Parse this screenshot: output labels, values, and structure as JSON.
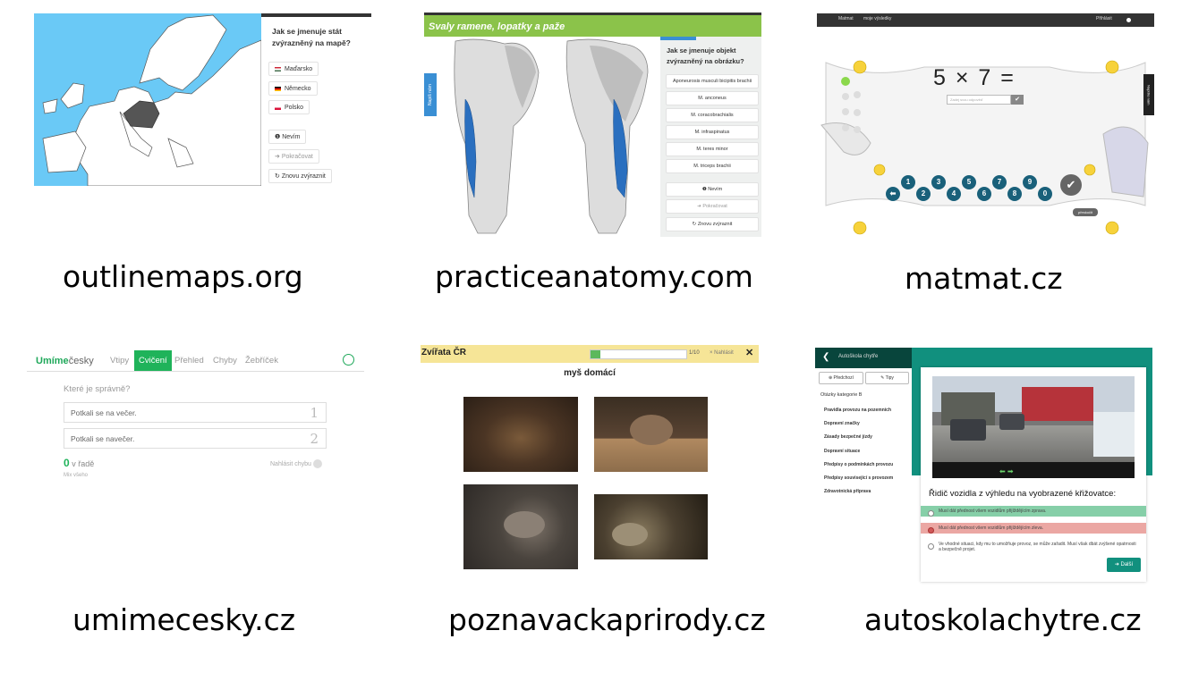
{
  "colors": {
    "map_sea": "#6ac9f6",
    "anatomy_green": "#8bc34a",
    "umime_green": "#1fb35a",
    "poznavacka_yellow": "#f6e597",
    "autoskola_teal": "#11907e"
  },
  "captions": {
    "outlinemaps": "outlinemaps.org",
    "practiceanatomy": "practiceanatomy.com",
    "matmat": "matmat.cz",
    "umimecesky": "umimecesky.cz",
    "poznavackaprirody": "poznavackaprirody.cz",
    "autoskolachytre": "autoskolachytre.cz"
  },
  "outlinemaps": {
    "question": "Jak se jmenuje stát zvýrazněný na mapě?",
    "options": [
      "Maďarsko",
      "Německo",
      "Polsko"
    ],
    "dont_know": "Nevím",
    "continue": "Pokračovat",
    "rehighlight": "Znovu zvýraznit"
  },
  "practiceanatomy": {
    "title": "Svaly ramene, lopatky a paže",
    "feedback": "Napiš nám",
    "question": "Jak se jmenuje objekt zvýrazněný na obrázku?",
    "options": [
      "Aponeurosis musculi bicipitis brachii",
      "M. anconeus",
      "M. coracobrachialis",
      "M. infraspinatus",
      "M. teres minor",
      "M. triceps brachii"
    ],
    "dont_know": "Nevím",
    "continue": "Pokračovat",
    "rehighlight": "Znovu zvýraznit"
  },
  "matmat": {
    "nav": [
      "Matmat",
      "moje výsledky"
    ],
    "user": "Přihlásit",
    "expression": "5 × 7  =",
    "input_placeholder": "Zadej svou odpověď",
    "ok": "✔",
    "keys": [
      "1",
      "2",
      "3",
      "4",
      "5",
      "6",
      "7",
      "8",
      "9",
      "0"
    ],
    "skip": "přeskočit",
    "feedback": "Napište nám"
  },
  "umimecesky": {
    "logo_a": "Umíme",
    "logo_b": "česky",
    "tabs": [
      "Vtipy",
      "Cvičení",
      "Přehled",
      "Chyby",
      "Žebříček"
    ],
    "active_tab": "Cvičení",
    "question": "Které je správně?",
    "answers": [
      {
        "text": "Potkali se na večer.",
        "num": "1"
      },
      {
        "text": "Potkali se navečer.",
        "num": "2"
      }
    ],
    "streak_count": "0",
    "streak_label": "v řadě",
    "mix": "Mix všeho",
    "report": "Nahlásit chybu"
  },
  "poznavackaprirody": {
    "title": "Zvířata ČR",
    "progress": 0.1,
    "count": "1/10",
    "report": "× Nahlásit",
    "close": "✕",
    "word": "myš domácí"
  },
  "autoskolachytre": {
    "header": "Autoškola chytře",
    "btn_back": "Předchozí",
    "btn_tip": "Tipy",
    "category": "Otázky kategorie B",
    "items": [
      "Pravidla provozu na pozemních",
      "Dopravní značky",
      "Zásady bezpečné jízdy",
      "Dopravní situace",
      "Předpisy o podmínkách provozu",
      "Předpisy související s provozem",
      "Zdravotnická příprava"
    ],
    "question": "Řidič vozidla z výhledu na vyobrazené křižovatce:",
    "answers": [
      "Musí dát přednost všem vozidlům přijíždějícím zprava.",
      "Musí dát přednost všem vozidlům přijíždějícím zleva.",
      "Ve vhodné situaci, kdy mu to umožňuje provoz, se může zařadit. Musí však dbát zvýšené opatrnosti a bezpečně projet."
    ],
    "next": "Další"
  }
}
